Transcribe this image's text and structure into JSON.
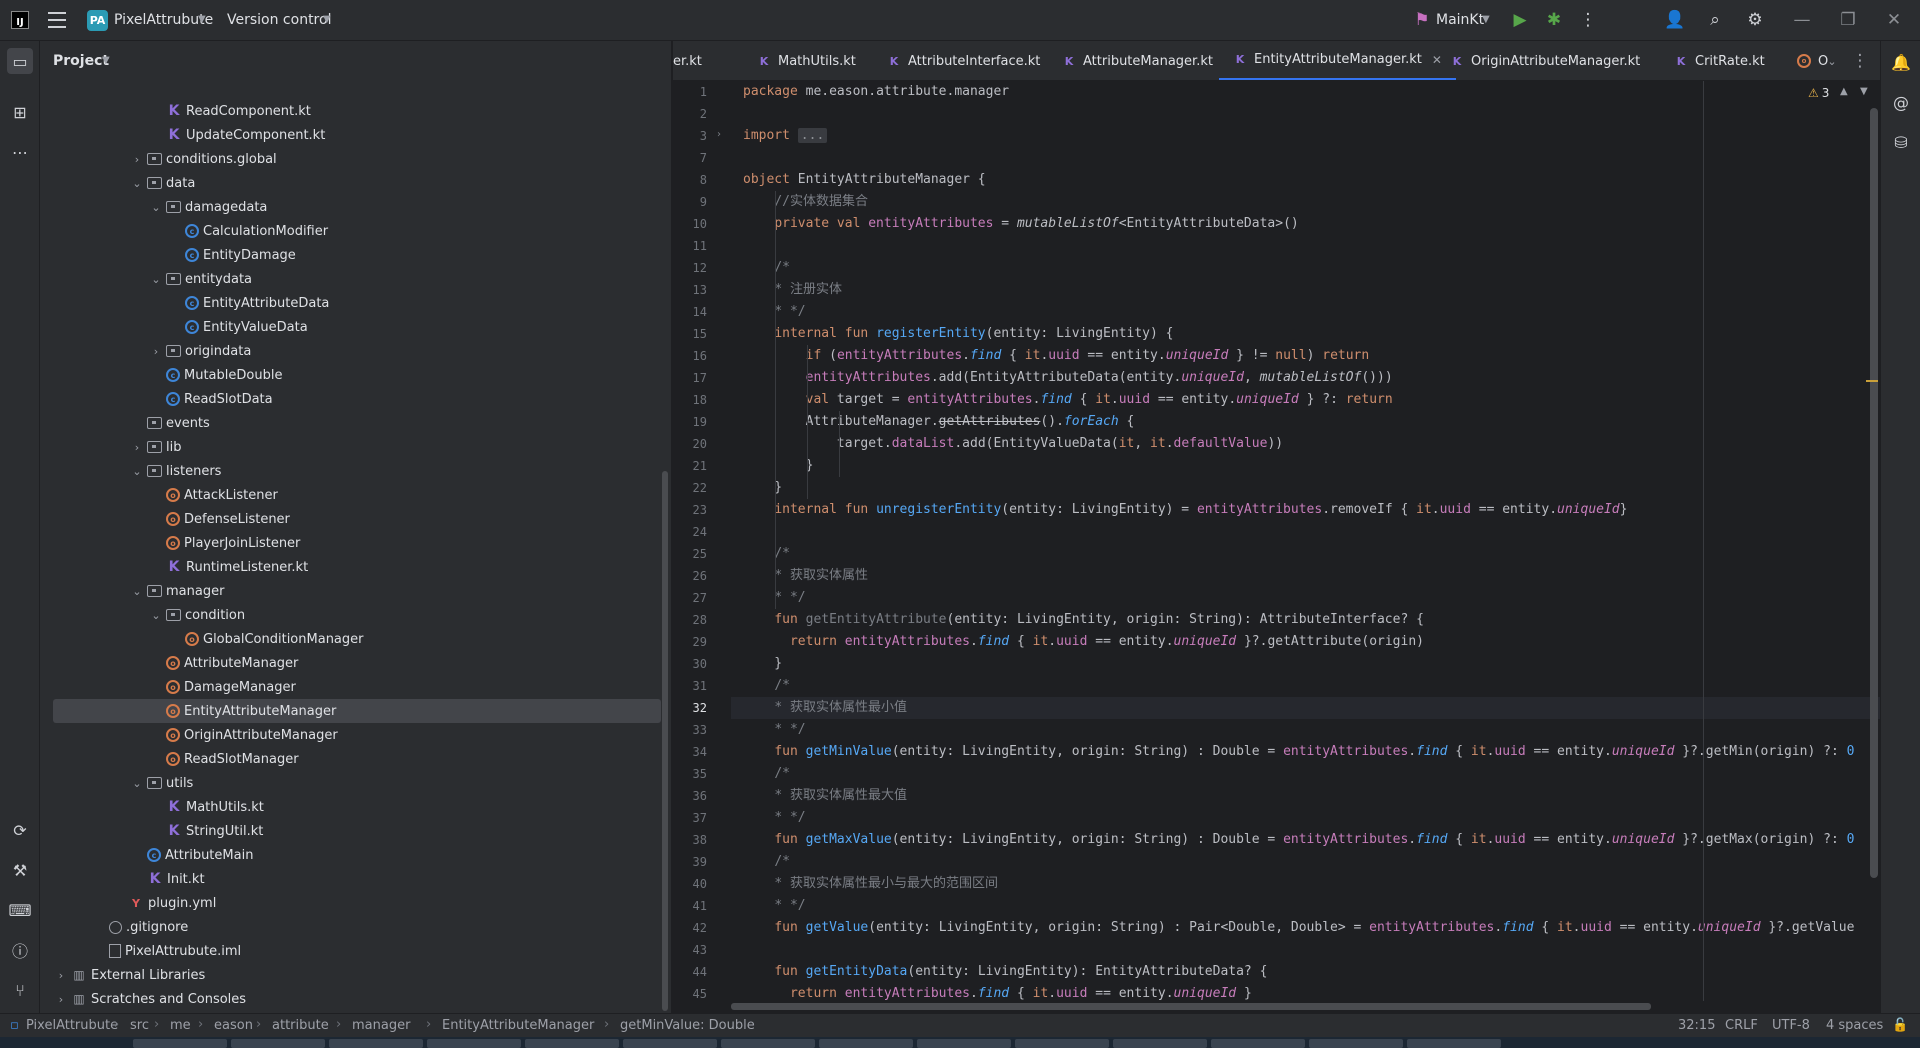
{
  "titlebar": {
    "app_logo": "IJ",
    "project_badge": "PA",
    "project_name": "PixelAttrubute",
    "vcs_label": "Version control",
    "run_config": "MainKt"
  },
  "project_panel": {
    "title": "Project",
    "items": [
      {
        "label": "ReadComponent.kt",
        "icon": "kt",
        "indent": 5,
        "chev": ""
      },
      {
        "label": "UpdateComponent.kt",
        "icon": "kt",
        "indent": 5,
        "chev": ""
      },
      {
        "label": "conditions.global",
        "icon": "pkg",
        "indent": 4,
        "chev": "›"
      },
      {
        "label": "data",
        "icon": "pkg",
        "indent": 4,
        "chev": "⌄"
      },
      {
        "label": "damagedata",
        "icon": "pkg",
        "indent": 5,
        "chev": "⌄"
      },
      {
        "label": "CalculationModifier",
        "icon": "class",
        "indent": 6,
        "chev": ""
      },
      {
        "label": "EntityDamage",
        "icon": "class",
        "indent": 6,
        "chev": ""
      },
      {
        "label": "entitydata",
        "icon": "pkg",
        "indent": 5,
        "chev": "⌄"
      },
      {
        "label": "EntityAttributeData",
        "icon": "class",
        "indent": 6,
        "chev": ""
      },
      {
        "label": "EntityValueData",
        "icon": "class",
        "indent": 6,
        "chev": ""
      },
      {
        "label": "origindata",
        "icon": "pkg",
        "indent": 5,
        "chev": "›"
      },
      {
        "label": "MutableDouble",
        "icon": "class",
        "indent": 5,
        "chev": ""
      },
      {
        "label": "ReadSlotData",
        "icon": "class",
        "indent": 5,
        "chev": ""
      },
      {
        "label": "events",
        "icon": "pkg",
        "indent": 4,
        "chev": ""
      },
      {
        "label": "lib",
        "icon": "pkg",
        "indent": 4,
        "chev": "›"
      },
      {
        "label": "listeners",
        "icon": "pkg",
        "indent": 4,
        "chev": "⌄"
      },
      {
        "label": "AttackListener",
        "icon": "obj",
        "indent": 5,
        "chev": ""
      },
      {
        "label": "DefenseListener",
        "icon": "obj",
        "indent": 5,
        "chev": ""
      },
      {
        "label": "PlayerJoinListener",
        "icon": "obj",
        "indent": 5,
        "chev": ""
      },
      {
        "label": "RuntimeListener.kt",
        "icon": "kt",
        "indent": 5,
        "chev": ""
      },
      {
        "label": "manager",
        "icon": "pkg",
        "indent": 4,
        "chev": "⌄"
      },
      {
        "label": "condition",
        "icon": "pkg",
        "indent": 5,
        "chev": "⌄"
      },
      {
        "label": "GlobalConditionManager",
        "icon": "obj",
        "indent": 6,
        "chev": ""
      },
      {
        "label": "AttributeManager",
        "icon": "obj",
        "indent": 5,
        "chev": ""
      },
      {
        "label": "DamageManager",
        "icon": "obj",
        "indent": 5,
        "chev": ""
      },
      {
        "label": "EntityAttributeManager",
        "icon": "obj",
        "indent": 5,
        "chev": "",
        "selected": true
      },
      {
        "label": "OriginAttributeManager",
        "icon": "obj",
        "indent": 5,
        "chev": ""
      },
      {
        "label": "ReadSlotManager",
        "icon": "obj",
        "indent": 5,
        "chev": ""
      },
      {
        "label": "utils",
        "icon": "pkg",
        "indent": 4,
        "chev": "⌄"
      },
      {
        "label": "MathUtils.kt",
        "icon": "kt",
        "indent": 5,
        "chev": ""
      },
      {
        "label": "StringUtil.kt",
        "icon": "kt",
        "indent": 5,
        "chev": ""
      },
      {
        "label": "AttributeMain",
        "icon": "class",
        "indent": 4,
        "chev": ""
      },
      {
        "label": "Init.kt",
        "icon": "kt",
        "indent": 4,
        "chev": ""
      },
      {
        "label": "plugin.yml",
        "icon": "yml",
        "indent": 3,
        "chev": ""
      },
      {
        "label": ".gitignore",
        "icon": "ignore",
        "indent": 2,
        "chev": ""
      },
      {
        "label": "PixelAttrubute.iml",
        "icon": "iml",
        "indent": 2,
        "chev": ""
      },
      {
        "label": "External Libraries",
        "icon": "lib",
        "indent": 0,
        "chev": "›"
      },
      {
        "label": "Scratches and Consoles",
        "icon": "lib",
        "indent": 0,
        "chev": "›"
      }
    ]
  },
  "tabs": [
    {
      "label": "er.kt",
      "icon": "kt"
    },
    {
      "label": "MathUtils.kt",
      "icon": "kt"
    },
    {
      "label": "AttributeInterface.kt",
      "icon": "kt"
    },
    {
      "label": "AttributeManager.kt",
      "icon": "kt"
    },
    {
      "label": "EntityAttributeManager.kt",
      "icon": "kt",
      "active": true
    },
    {
      "label": "OriginAttributeManager.kt",
      "icon": "kt"
    },
    {
      "label": "CritRate.kt",
      "icon": "kt"
    },
    {
      "label": "O",
      "icon": "obj"
    }
  ],
  "editor": {
    "warning_count": "3",
    "current_line": "32",
    "line_numbers": [
      "1",
      "2",
      "3",
      "7",
      "8",
      "9",
      "10",
      "11",
      "12",
      "13",
      "14",
      "15",
      "16",
      "17",
      "18",
      "19",
      "20",
      "21",
      "22",
      "23",
      "24",
      "25",
      "26",
      "27",
      "28",
      "29",
      "30",
      "31",
      "32",
      "33",
      "34",
      "35",
      "36",
      "37",
      "38",
      "39",
      "40",
      "41",
      "42",
      "43",
      "44",
      "45"
    ],
    "lines": [
      "<span class='kw'>package</span> me.eason.attribute.manager",
      "",
      "<span class='kw'>import</span> <span class='fold'>...</span>",
      "",
      "<span class='kw'>object</span> EntityAttributeManager {",
      "    <span class='cmt'>//实体数据集合</span>",
      "    <span class='kw'>private val</span> <span class='prop'>entityAttributes</span> = <span class='ital'>mutableListOf</span>&lt;EntityAttributeData&gt;()",
      "",
      "    <span class='cmt'>/*</span>",
      "    <span class='cmt'>* 注册实体</span>",
      "    <span class='cmt'>* */</span>",
      "    <span class='kw'>internal fun</span> <span class='fn'>registerEntity</span>(entity: LivingEntity) {",
      "        <span class='kw'>if</span> (<span class='prop'>entityAttributes</span>.<span class='ext'>find</span> { <span class='kw'>it</span>.<span class='prop'>uuid</span> == entity.<span class='prop ital'>uniqueId</span> } != <span class='kw'>null</span>) <span class='kw'>return</span>",
      "        <span class='prop'>entityAttributes</span>.add(EntityAttributeData(entity.<span class='prop ital'>uniqueId</span>, <span class='ital'>mutableListOf</span>()))",
      "        <span class='kw'>val</span> target = <span class='prop'>entityAttributes</span>.<span class='ext'>find</span> { <span class='kw'>it</span>.<span class='prop'>uuid</span> == entity.<span class='prop ital'>uniqueId</span> } ?: <span class='kw'>return</span>",
      "        AttributeManager.<span class='strike'>getAttributes</span>().<span class='ext'>forEach</span> {",
      "            target.<span class='prop'>dataList</span>.add(EntityValueData(<span class='kw'>it</span>, <span class='kw'>it</span>.<span class='prop'>defaultValue</span>))",
      "        }",
      "    }",
      "    <span class='kw'>internal fun</span> <span class='fn'>unregisterEntity</span>(entity: LivingEntity) = <span class='prop'>entityAttributes</span>.removeIf { <span class='kw'>it</span>.<span class='prop'>uuid</span> == entity.<span class='prop ital'>uniqueId</span>}",
      "",
      "    <span class='cmt'>/*</span>",
      "    <span class='cmt'>* 获取实体属性</span>",
      "    <span class='cmt'>* */</span>",
      "    <span class='kw'>fun</span> <span class='cmt'>getEntityAttribute</span>(entity: LivingEntity, origin: String): AttributeInterface? {",
      "      <span class='kw'>return</span> <span class='prop'>entityAttributes</span>.<span class='ext'>find</span> { <span class='kw'>it</span>.<span class='prop'>uuid</span> == entity.<span class='prop ital'>uniqueId</span> }?.getAttribute(origin)",
      "    }",
      "    <span class='cmt'>/*</span>",
      "    <span class='cmt'>* 获取实体属性最小值</span>",
      "    <span class='cmt'>* */</span>",
      "    <span class='kw'>fun</span> <span class='fn'>getMinValue</span>(entity: LivingEntity, origin: String) : Double = <span class='prop'>entityAttributes</span>.<span class='ext'>find</span> { <span class='kw'>it</span>.<span class='prop'>uuid</span> == entity.<span class='prop ital'>uniqueId</span> }?.getMin(origin) ?: <span class='fn'>0</span>",
      "    <span class='cmt'>/*</span>",
      "    <span class='cmt'>* 获取实体属性最大值</span>",
      "    <span class='cmt'>* */</span>",
      "    <span class='kw'>fun</span> <span class='fn'>getMaxValue</span>(entity: LivingEntity, origin: String) : Double = <span class='prop'>entityAttributes</span>.<span class='ext'>find</span> { <span class='kw'>it</span>.<span class='prop'>uuid</span> == entity.<span class='prop ital'>uniqueId</span> }?.getMax(origin) ?: <span class='fn'>0</span>",
      "    <span class='cmt'>/*</span>",
      "    <span class='cmt'>* 获取实体属性最小与最大的范围区间</span>",
      "    <span class='cmt'>* */</span>",
      "    <span class='kw'>fun</span> <span class='fn'>getValue</span>(entity: LivingEntity, origin: String) : Pair&lt;Double, Double&gt; = <span class='prop'>entityAttributes</span>.<span class='ext'>find</span> { <span class='kw'>it</span>.<span class='prop'>uuid</span> == entity.<span class='prop ital'>uniqueId</span> }?.getValue",
      "",
      "    <span class='kw'>fun</span> <span class='fn'>getEntityData</span>(entity: LivingEntity): EntityAttributeData? {",
      "      <span class='kw'>return</span> <span class='prop'>entityAttributes</span>.<span class='ext'>find</span> { <span class='kw'>it</span>.<span class='prop'>uuid</span> == entity.<span class='prop ital'>uniqueId</span> }"
    ]
  },
  "statusbar": {
    "breadcrumbs": [
      "PixelAttrubute",
      "src",
      "me",
      "eason",
      "attribute",
      "manager",
      "EntityAttributeManager",
      "getMinValue: Double"
    ],
    "position": "32:15",
    "line_sep": "CRLF",
    "encoding": "UTF-8",
    "indent": "4 spaces"
  }
}
